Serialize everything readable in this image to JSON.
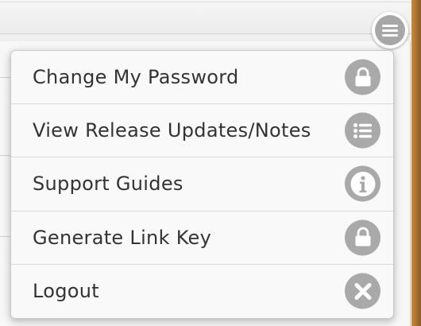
{
  "theme": {
    "icon_color": "#a9a9a9",
    "text_color": "#333333",
    "menu_bg": "#f9f9f9"
  },
  "header": {
    "menu_icon": "hamburger-menu-icon"
  },
  "menu": {
    "items": [
      {
        "label": "Change My Password",
        "icon": "lock-icon"
      },
      {
        "label": "View Release Updates/Notes",
        "icon": "list-icon"
      },
      {
        "label": "Support Guides",
        "icon": "info-icon"
      },
      {
        "label": "Generate Link Key",
        "icon": "lock-icon"
      },
      {
        "label": "Logout",
        "icon": "close-icon"
      }
    ]
  }
}
